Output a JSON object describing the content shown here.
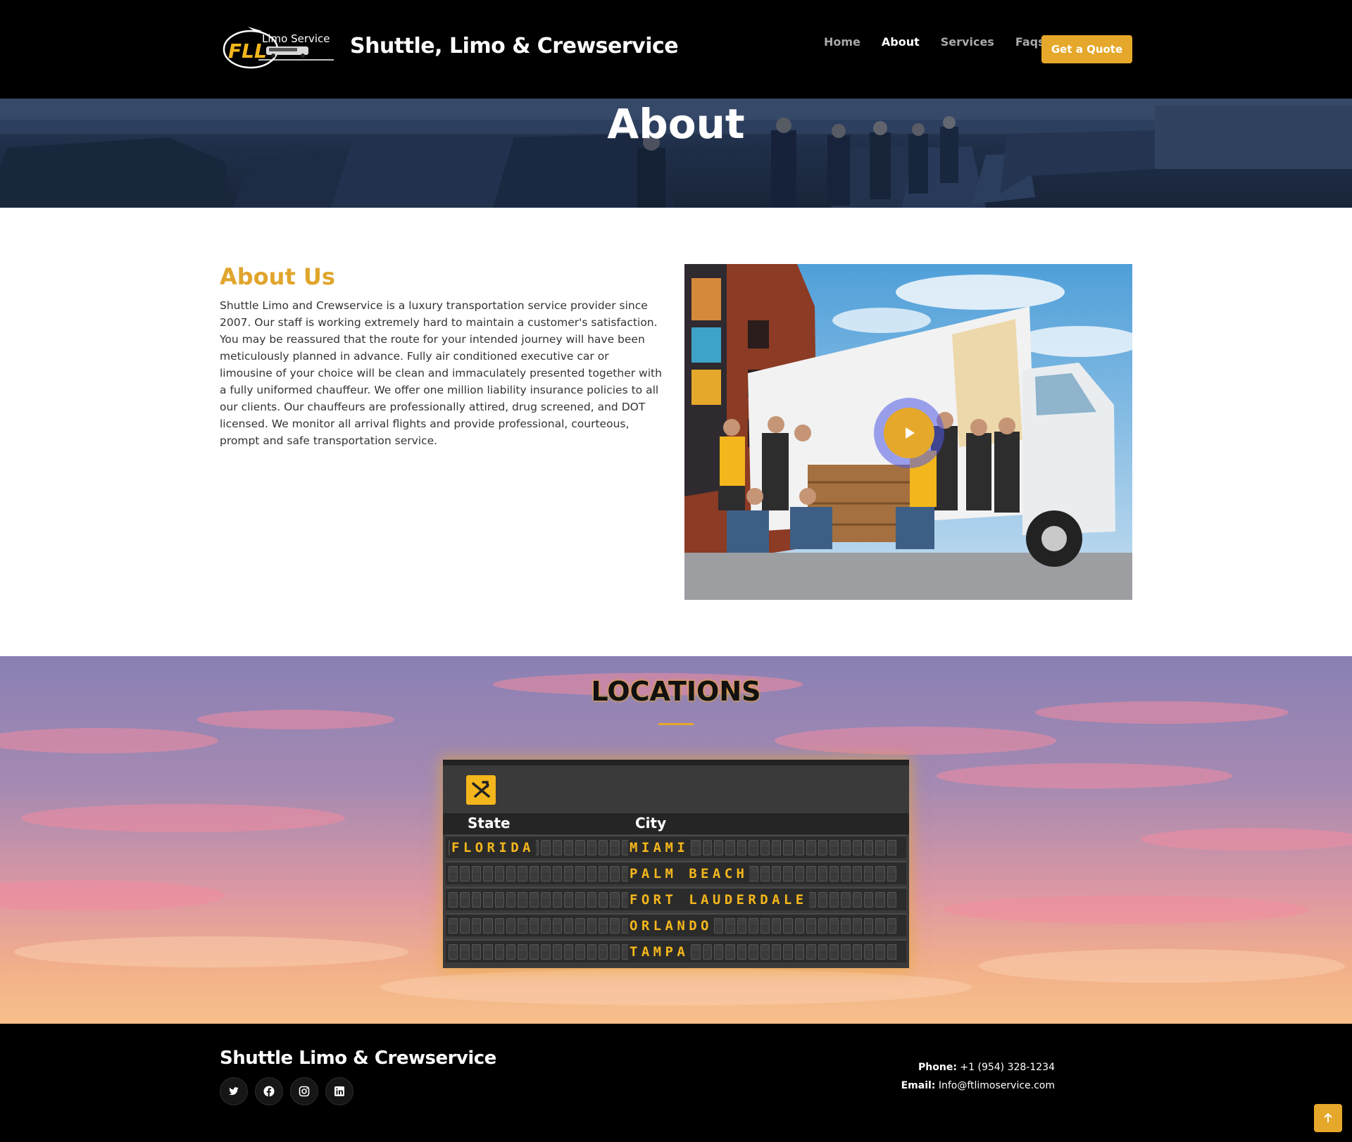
{
  "header": {
    "logo_text": "FLL",
    "logo_subtext": "Limo Service",
    "site_title": "Shuttle, Limo & Crewservice",
    "nav": [
      {
        "label": "Home",
        "active": false
      },
      {
        "label": "About",
        "active": true
      },
      {
        "label": "Services",
        "active": false
      },
      {
        "label": "Faqs",
        "active": false
      }
    ],
    "cta_label": "Get a Quote"
  },
  "hero": {
    "title": "About"
  },
  "about": {
    "heading": "About Us",
    "body": "Shuttle Limo and Crewservice is a luxury transportation service provider since 2007. Our staff is working extremely hard to maintain a customer's satisfaction. You may be reassured that the route for your intended journey will have been meticulously planned in advance. Fully air conditioned executive car or limousine of your choice will be clean and immaculately presented together with a fully uniformed chauffeur. We offer one million liability insurance policies to all our clients. Our chauffeurs are professionally attired, drug screened, and DOT licensed. We monitor all arrival flights and provide professional, courteous, prompt and safe transportation service.",
    "video": {
      "icon": "play-icon"
    }
  },
  "locations": {
    "title": "LOCATIONS",
    "icon": "airport-icon",
    "col_state": "State",
    "col_city": "City",
    "rows": [
      {
        "state": "FLORIDA",
        "city": "MIAMI"
      },
      {
        "state": "",
        "city": "PALM BEACH"
      },
      {
        "state": "",
        "city": "FORT LAUDERDALE"
      },
      {
        "state": "",
        "city": "ORLANDO"
      },
      {
        "state": "",
        "city": "TAMPA"
      }
    ]
  },
  "footer": {
    "title": "Shuttle Limo & Crewservice",
    "social": [
      "twitter-icon",
      "facebook-icon",
      "instagram-icon",
      "linkedin-icon"
    ],
    "phone_label": "Phone:",
    "phone": "+1 (954) 328-1234",
    "email_label": "Email:",
    "email": "Info@ftlimoservice.com"
  },
  "colors": {
    "accent": "#e5a82a",
    "board_text": "#f3b61c",
    "header_bg": "#000000"
  }
}
